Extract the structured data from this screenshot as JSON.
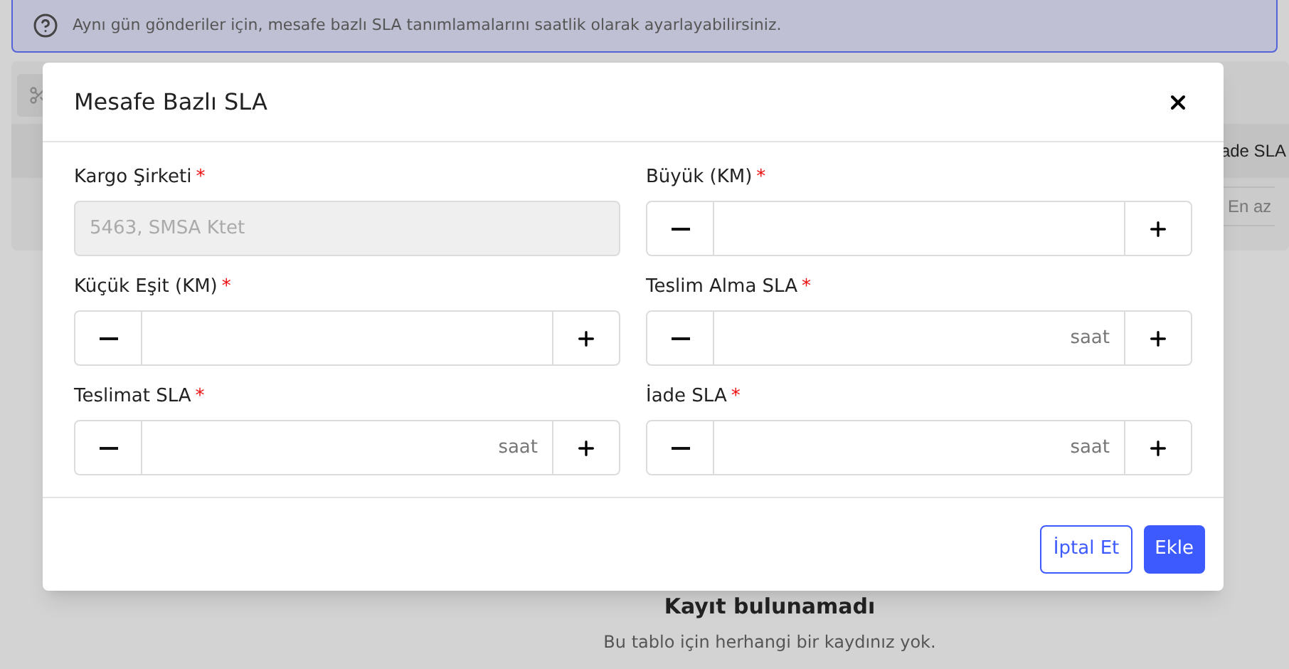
{
  "banner": {
    "text": "Aynı gün gönderiler için, mesafe bazlı SLA tanımlamalarını saatlik olarak ayarlayabilirsiniz."
  },
  "table": {
    "column_header": "ade SLA",
    "filter_placeholder": "En az",
    "empty_title": "Kayıt bulunamadı",
    "empty_text": "Bu tablo için herhangi bir kaydınız yok."
  },
  "modal": {
    "title": "Mesafe Bazlı SLA",
    "required_symbol": "*",
    "fields": [
      {
        "kind": "select",
        "label": "Kargo Şirketi",
        "required": true,
        "value": "5463, SMSA Ktet",
        "disabled": true
      },
      {
        "kind": "stepper",
        "label": "Büyük (KM)",
        "required": true
      },
      {
        "kind": "stepper",
        "label": "Küçük Eşit (KM)",
        "required": true
      },
      {
        "kind": "stepper",
        "label": "Teslim Alma SLA",
        "required": true,
        "unit": "saat"
      },
      {
        "kind": "stepper",
        "label": "Teslimat SLA",
        "required": true,
        "unit": "saat"
      },
      {
        "kind": "stepper",
        "label": "İade SLA",
        "required": true,
        "unit": "saat"
      }
    ],
    "buttons": [
      {
        "label": "İptal Et",
        "kind": "secondary"
      },
      {
        "label": "Ekle",
        "kind": "primary"
      }
    ]
  }
}
